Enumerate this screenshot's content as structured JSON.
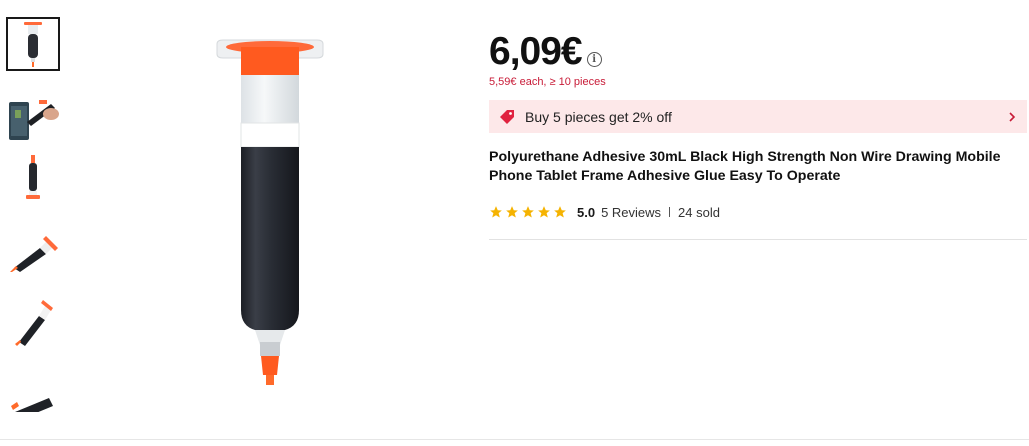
{
  "product": {
    "price": "6,09€",
    "bulk_price": "5,59€ each, ≥ 10 pieces",
    "promo": "Buy 5 pieces get 2% off",
    "title": "Polyurethane Adhesive 30mL Black High Strength Non Wire Drawing Mobile Phone Tablet Frame Adhesive Glue Easy To Operate",
    "rating": "5.0",
    "reviews": "5 Reviews",
    "sold": "24 sold",
    "star_count": 5
  },
  "icons": {
    "info": "i",
    "promo_tag": "tag-icon",
    "chevron": "chevron-right-icon",
    "star": "star-icon"
  },
  "colors": {
    "accent_red": "#c81b37",
    "promo_bg": "#fde8e9",
    "star": "#f5b301",
    "syringe_orange": "#ff5a1f"
  },
  "gallery": {
    "thumbnail_count": 6,
    "selected_index": 0
  }
}
